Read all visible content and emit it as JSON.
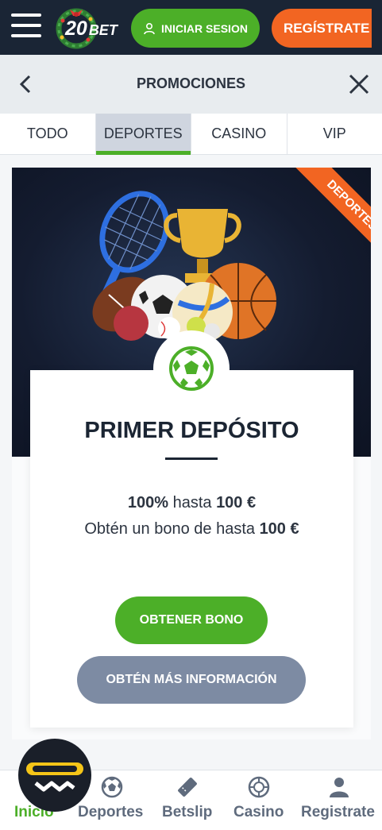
{
  "topbar": {
    "logo_number": "20",
    "logo_text": "BET",
    "login_label": "INICIAR SESION",
    "register_label": "REGÍSTRATE"
  },
  "header": {
    "title": "PROMOCIONES"
  },
  "tabs": [
    {
      "label": "TODO",
      "active": false
    },
    {
      "label": "DEPORTES",
      "active": true
    },
    {
      "label": "CASINO",
      "active": false
    },
    {
      "label": "VIP",
      "active": false
    }
  ],
  "promo": {
    "ribbon": "DEPORTES",
    "title": "PRIMER DEPÓSITO",
    "line1_bold": "100%",
    "line1_text": " hasta ",
    "line1_amount": "100 €",
    "line2_text": "Obtén un bono de hasta ",
    "line2_amount": "100 €",
    "bonus_button": "OBTENER BONO",
    "info_button": "OBTÉN MÁS INFORMACIÓN"
  },
  "bottom_nav": [
    {
      "label": "Inicio",
      "icon": "home-icon",
      "active": true
    },
    {
      "label": "Deportes",
      "icon": "soccer-ball-icon",
      "active": false
    },
    {
      "label": "Betslip",
      "icon": "ticket-icon",
      "active": false
    },
    {
      "label": "Casino",
      "icon": "roulette-icon",
      "active": false
    },
    {
      "label": "Registrate",
      "icon": "user-icon",
      "active": false
    }
  ],
  "colors": {
    "topbar": "#1a2535",
    "green": "#4caf28",
    "orange": "#f26522",
    "grey_button": "#7d8ba3"
  }
}
